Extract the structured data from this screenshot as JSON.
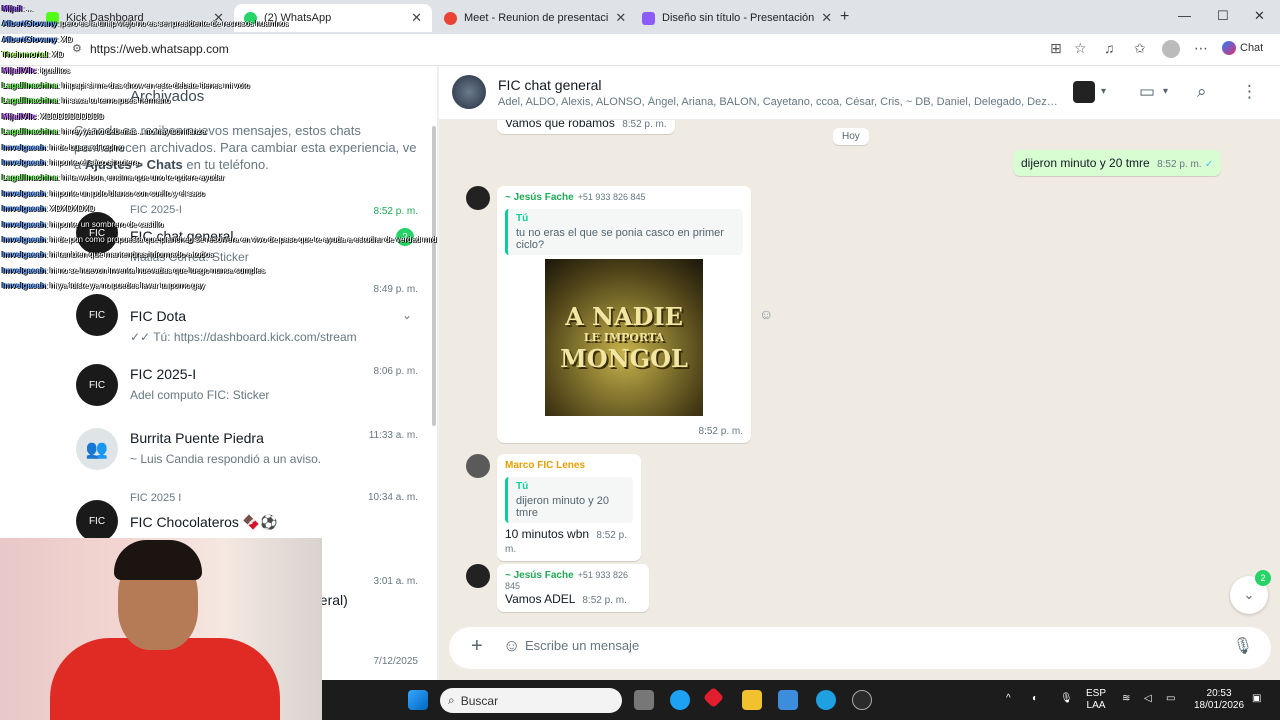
{
  "browser": {
    "tabs": [
      {
        "label": "Kick Dashboard",
        "active": false
      },
      {
        "label": "(2) WhatsApp",
        "active": true
      },
      {
        "label": "Meet - Reunion de presentaci",
        "active": false
      },
      {
        "label": "Diseño sin título - Presentación",
        "active": false
      }
    ],
    "url": "https://web.whatsapp.com",
    "chat_label": "Chat"
  },
  "left": {
    "archived_title": "Archivados",
    "archived_desc": "Cuando se reciben nuevos mensajes, estos chats permanecen archivados. Para cambiar esta experiencia, ve a",
    "archived_desc_link": "Ajustes > Chats",
    "archived_desc_tail": "en tu teléfono.",
    "chats": [
      {
        "sub": "FIC 2025-I",
        "name": "FIC chat general",
        "time": "8:52 p. m.",
        "last": "Matias Correa: Sticker",
        "unread": "2"
      },
      {
        "sub": "",
        "name": "FIC Dota",
        "time": "8:49 p. m.",
        "last": "✓✓ Tú: https://dashboard.kick.com/stream",
        "unread": ""
      },
      {
        "sub": "",
        "name": "FIC 2025-I",
        "time": "8:06 p. m.",
        "last": "Adel computo FIC: Sticker",
        "unread": ""
      },
      {
        "sub": "",
        "name": "Burrita Puente Piedra",
        "time": "11:33 a. m.",
        "last": "~ Luis Candia respondió a un aviso.",
        "unread": ""
      },
      {
        "sub": "FIC 2025 I",
        "name": "FIC Chocolateros 🍫⚽",
        "time": "10:34 a. m.",
        "last": "",
        "unread": ""
      },
      {
        "sub": "",
        "name": "neral)",
        "time": "3:01 a. m.",
        "last": "",
        "unread": ""
      },
      {
        "sub": "",
        "name": "",
        "time": "7/12/2025",
        "last": "",
        "unread": ""
      }
    ]
  },
  "header": {
    "title": "FIC chat general",
    "members": "Adel, ALDO, Alexis, ALONSO, Ángel, Ariana, BALON, Cayetano, ccoa, César, Cris, ~ DB, Daniel, Delegado, Dezel, ..."
  },
  "messages": {
    "top_text": "Vamos que robamos",
    "top_time": "8:52 p. m.",
    "date_chip": "Hoy",
    "outgoing_text": "dijeron minuto y 20 tmre",
    "outgoing_time": "8:52 p. m.",
    "m1_sender": "~ Jesús Fache",
    "m1_phone": "+51 933 826 845",
    "m1_quote_who": "Tú",
    "m1_quote_text": "tu no eras el que se ponia casco en primer ciclo?",
    "m1_sticker_l1": "A NADIE",
    "m1_sticker_l2": "LE IMPORTA",
    "m1_sticker_l3": "MONGOL",
    "m1_time": "8:52 p. m.",
    "m2_sender": "Marco FIC Lenes",
    "m2_quote_who": "Tú",
    "m2_quote_text": "dijeron minuto y 20 tmre",
    "m2_text": "10 minutos wbn",
    "m2_time": "8:52 p. m.",
    "m3_sender": "~ Jesús Fache",
    "m3_phone": "+51 933 826 845",
    "m3_text": "Vamos ADEL",
    "m3_time": "8:52 p. m.",
    "scroll_badge": "2"
  },
  "composer": {
    "placeholder": "Escribe un mensaje"
  },
  "stream_chat": [
    {
      "user": "Mijail",
      "text": ": ..."
    },
    {
      "user": "AlbertGiovany",
      "text": ": pero es la uni p viejo no es ser presidente de recrusos huamnos"
    },
    {
      "user": "AlbertGiovany",
      "text": ": XD"
    },
    {
      "user": "Theinmortal",
      "text": ": XD"
    },
    {
      "user": "MijailVilc",
      "text": ": igualitos"
    },
    {
      "user": "Lagallinachina",
      "text": ": hi papi si me das chow en este debate tienes mi voto"
    },
    {
      "user": "Lagallinachina",
      "text": ": hi saca tu terno pues hermano"
    },
    {
      "user": "MijailVilc",
      "text": ": XDDDDDDDDDD"
    },
    {
      "user": "Lagallinachina",
      "text": ": hi rey ya no deberias ...no hay confianza"
    },
    {
      "user": "Imvelgaeah",
      "text": ": hi de busca el tepino"
    },
    {
      "user": "Imvelgaeah",
      "text": ": hi ponte el saco si quiera"
    },
    {
      "user": "Lagallinachina",
      "text": ": hi ta webon, encima que uno te quiere ayudar"
    },
    {
      "user": "Imvelgaeah",
      "text": ": hi ponte un polo blanco con cuello y el saco"
    },
    {
      "user": "Imvelgaeah",
      "text": ": XDXDXDXD"
    },
    {
      "user": "Imvelgaeah",
      "text": ": hi ponte un sombrero de castillo"
    },
    {
      "user": "Imvelgaeah",
      "text": ": hi de pon como propuesta que plancheo se resolvera en vivo de paso que te ayuda a estudiar de verdad mrd"
    },
    {
      "user": "Imvelgaeah",
      "text": ": hi tambien que mantendras informado a todos"
    },
    {
      "user": "Imvelgaeah",
      "text": ": hi no se huevon inventa huevadas que luego nunca cumples"
    },
    {
      "user": "Imvelgaeah",
      "text": ": hi ya fuiste ya no puedes lavar tu porno gay"
    }
  ],
  "taskbar": {
    "search": "Buscar",
    "lang1": "ESP",
    "lang2": "LAA",
    "time": "20:53",
    "date": "18/01/2026"
  },
  "colors": {
    "accent": "#25d366",
    "quote_bar": "#06cf9c",
    "outgoing_bubble": "#d9fdd3",
    "wallpaper": "#efeae2"
  }
}
